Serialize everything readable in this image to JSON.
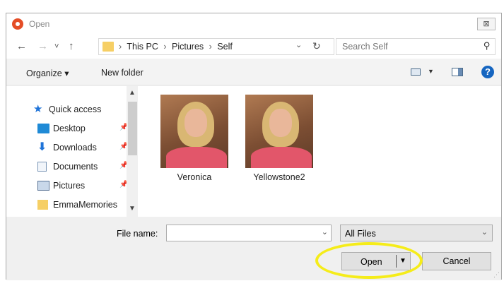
{
  "window": {
    "title": "Open",
    "close_glyph": "⊠"
  },
  "nav": {
    "back": "←",
    "forward": "→",
    "recent": "˅",
    "up": "↑"
  },
  "address": {
    "crumbs": [
      "This PC",
      "Pictures",
      "Self"
    ],
    "separator": "›",
    "dropdown": "⌄",
    "refresh": "↻"
  },
  "search": {
    "placeholder": "Search Self",
    "icon": "⚲"
  },
  "toolbar": {
    "organize": "Organize ▾",
    "new_folder": "New folder",
    "view_dropdown": "▼",
    "help": "?"
  },
  "sidebar": {
    "items": [
      {
        "label": "Quick access",
        "icon": "star-icon"
      },
      {
        "label": "Desktop",
        "icon": "desktop-icon",
        "pinned": true
      },
      {
        "label": "Downloads",
        "icon": "download-icon",
        "pinned": true
      },
      {
        "label": "Documents",
        "icon": "documents-icon",
        "pinned": true
      },
      {
        "label": "Pictures",
        "icon": "pictures-icon",
        "pinned": true
      },
      {
        "label": "EmmaMemories",
        "icon": "folder-icon"
      }
    ],
    "pin_glyph": "📌",
    "scroll_up": "▲",
    "scroll_down": "▼"
  },
  "files": [
    {
      "name": "Veronica"
    },
    {
      "name": "Yellowstone2"
    }
  ],
  "footer": {
    "file_name_label": "File name:",
    "file_name_value": "",
    "filter_value": "All Files",
    "open_label": "Open",
    "cancel_label": "Cancel",
    "dropdown": "⌄",
    "split_arrow": "▼"
  },
  "colors": {
    "highlight": "#f5ec1a",
    "help": "#1565c0",
    "accent_folder": "#f6cf65"
  }
}
